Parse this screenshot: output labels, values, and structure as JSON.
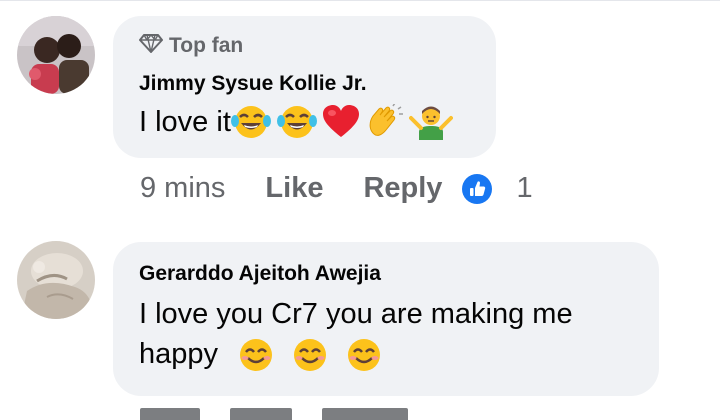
{
  "comments": [
    {
      "badge": {
        "icon": "diamond-icon",
        "label": "Top fan"
      },
      "author": "Jimmy Sysue Kollie Jr.",
      "text": "I love it",
      "emojis": [
        "laughing-tears-emoji",
        "laughing-tears-emoji",
        "red-heart-emoji",
        "clapping-hands-emoji",
        "shrugging-person-emoji"
      ],
      "time": "9 mins",
      "like_label": "Like",
      "reply_label": "Reply",
      "reaction_icon": "thumbs-up-icon",
      "reaction_count": "1"
    },
    {
      "author": "Gerarddo Ajeitoh Awejia",
      "text": "I love you Cr7 you are making me happy",
      "emojis": [
        "smiling-face-emoji",
        "smiling-face-emoji",
        "smiling-face-emoji"
      ]
    }
  ],
  "colors": {
    "bubble": "#f0f2f5",
    "secondary_text": "#65676b",
    "primary_text": "#050505",
    "like_blue": "#1877f2"
  }
}
